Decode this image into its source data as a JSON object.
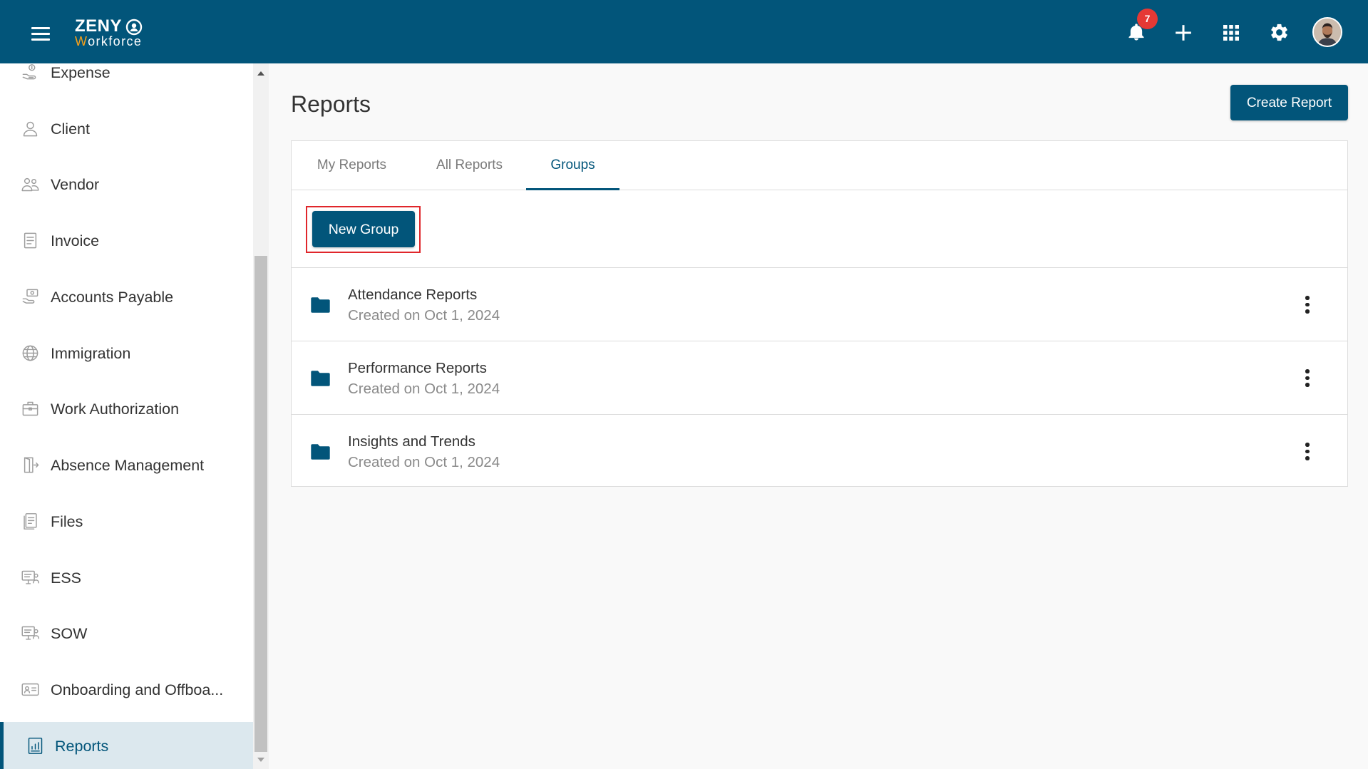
{
  "header": {
    "logo": {
      "name": "ZENY",
      "tagline": "Workforce"
    },
    "notifications": {
      "count": "7"
    },
    "icons": {
      "menu": "hamburger-menu-icon",
      "notifications": "bell-icon",
      "add": "plus-icon",
      "apps": "apps-grid-icon",
      "settings": "gear-icon",
      "profile": "user-avatar"
    }
  },
  "sidebar": {
    "items": [
      {
        "label": "Expense",
        "icon": "expense-icon"
      },
      {
        "label": "Client",
        "icon": "client-icon"
      },
      {
        "label": "Vendor",
        "icon": "vendor-icon"
      },
      {
        "label": "Invoice",
        "icon": "invoice-icon"
      },
      {
        "label": "Accounts Payable",
        "icon": "accounts-payable-icon"
      },
      {
        "label": "Immigration",
        "icon": "globe-icon"
      },
      {
        "label": "Work Authorization",
        "icon": "briefcase-icon"
      },
      {
        "label": "Absence Management",
        "icon": "door-exit-icon"
      },
      {
        "label": "Files",
        "icon": "files-icon"
      },
      {
        "label": "ESS",
        "icon": "ess-monitor-icon"
      },
      {
        "label": "SOW",
        "icon": "sow-monitor-icon"
      },
      {
        "label": "Onboarding and Offboa...",
        "icon": "id-card-icon"
      },
      {
        "label": "Reports",
        "icon": "reports-icon",
        "active": true
      }
    ]
  },
  "main": {
    "title": "Reports",
    "create_button": "Create Report",
    "tabs": [
      {
        "label": "My Reports",
        "active": false
      },
      {
        "label": "All Reports",
        "active": false
      },
      {
        "label": "Groups",
        "active": true
      }
    ],
    "new_group_button": "New Group",
    "groups": [
      {
        "name": "Attendance Reports",
        "created": "Created on Oct 1, 2024"
      },
      {
        "name": "Performance Reports",
        "created": "Created on Oct 1, 2024"
      },
      {
        "name": "Insights and Trends",
        "created": "Created on Oct 1, 2024"
      }
    ]
  },
  "colors": {
    "brand": "#02557a",
    "active_sidebar_bg": "#dce8ee",
    "badge": "#e53935",
    "highlight_outline": "#e0262b",
    "logo_accent": "#f6a01a"
  }
}
